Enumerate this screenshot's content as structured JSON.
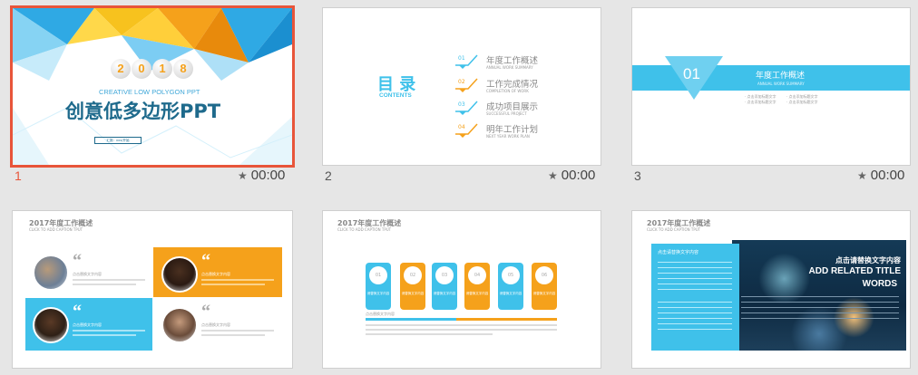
{
  "slides": [
    {
      "num": "1",
      "time": "00:00"
    },
    {
      "num": "2",
      "time": "00:00"
    },
    {
      "num": "3",
      "time": "00:00"
    },
    {
      "num": "4",
      "time": "00:00"
    },
    {
      "num": "5",
      "time": "00:00"
    },
    {
      "num": "6",
      "time": "00:04"
    }
  ],
  "s1": {
    "balls": [
      "2",
      "0",
      "1",
      "8"
    ],
    "subtitle": "CREATIVE LOW POLYGON PPT",
    "title": "创意低多边形PPT",
    "box": "汇报：xxx/开始"
  },
  "s2": {
    "title": "目 录",
    "sub": "CONTENTS",
    "items": [
      {
        "n": "01",
        "cn": "年度工作概述",
        "en": "ANNUAL WORK SUMMARY"
      },
      {
        "n": "02",
        "cn": "工作完成情况",
        "en": "COMPLETION OF WORK"
      },
      {
        "n": "03",
        "cn": "成功项目展示",
        "en": "SUCCESSFUL PROJECT"
      },
      {
        "n": "04",
        "cn": "明年工作计划",
        "en": "NEXT YEAR WORK PLAN"
      }
    ]
  },
  "s3": {
    "n": "01",
    "title": "年度工作概述",
    "sub": "ANNUAL WORK SUMMARY",
    "l1": "· 点击添加标题文字",
    "l2": "· 点击添加标题文字",
    "l3": "· 点击添加标题文字",
    "l4": "· 点击添加标题文字"
  },
  "s4": {
    "title": "2017年度工作概述",
    "sub": "CLICK TO ADD CAPTION TPUT",
    "q": "“",
    "lbl": "点击替换文字内容",
    "body": "请在此处添加文字内容"
  },
  "s5": {
    "title": "2017年度工作概述",
    "sub": "CLICK TO ADD CAPTION TPUT",
    "cards": [
      "01",
      "02",
      "03",
      "04",
      "05",
      "06"
    ],
    "ct": "请替换文字内容",
    "lbl": "点击替换文字内容"
  },
  "s6": {
    "title": "2017年度工作概述",
    "sub": "CLICK TO ADD CAPTION TPUT",
    "boxtitle": "点击请替换文字内容",
    "h1": "点击请替换文字内容",
    "h2": "ADD RELATED TITLE",
    "h3": "WORDS"
  },
  "colors": {
    "accent": "#e8553a",
    "blue": "#3fc1ea",
    "orange": "#f5a11b",
    "navy": "#1e6a8c"
  }
}
